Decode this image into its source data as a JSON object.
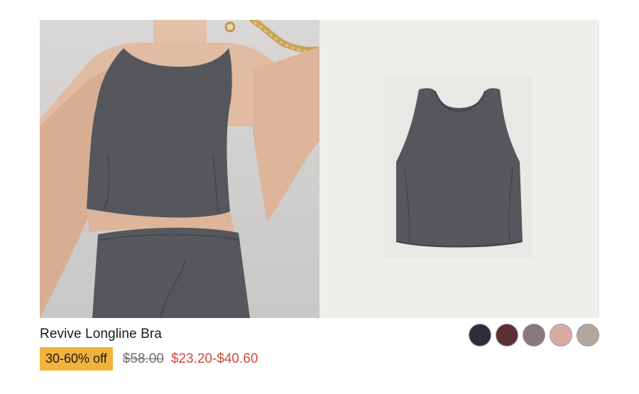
{
  "product": {
    "name": "Revive Longline Bra",
    "discount_badge": "30-60% off",
    "original_price": "$58.00",
    "sale_price": "$23.20-$40.60"
  },
  "gallery": {
    "images": [
      {
        "alt": "Model wearing the bra with matching leggings"
      },
      {
        "alt": "Product flat-lay of the bra"
      }
    ]
  },
  "swatches": [
    {
      "color": "#2a2f38",
      "label": "navy"
    },
    {
      "color": "#5c2f35",
      "label": "burgundy"
    },
    {
      "color": "#8a787d",
      "label": "mauve"
    },
    {
      "color": "#d8aba1",
      "label": "blush"
    },
    {
      "color": "#b3a79d",
      "label": "taupe"
    }
  ],
  "colors": {
    "badge_bg": "#f2b33d",
    "sale_price": "#d8453a",
    "garment": "#55575c"
  }
}
